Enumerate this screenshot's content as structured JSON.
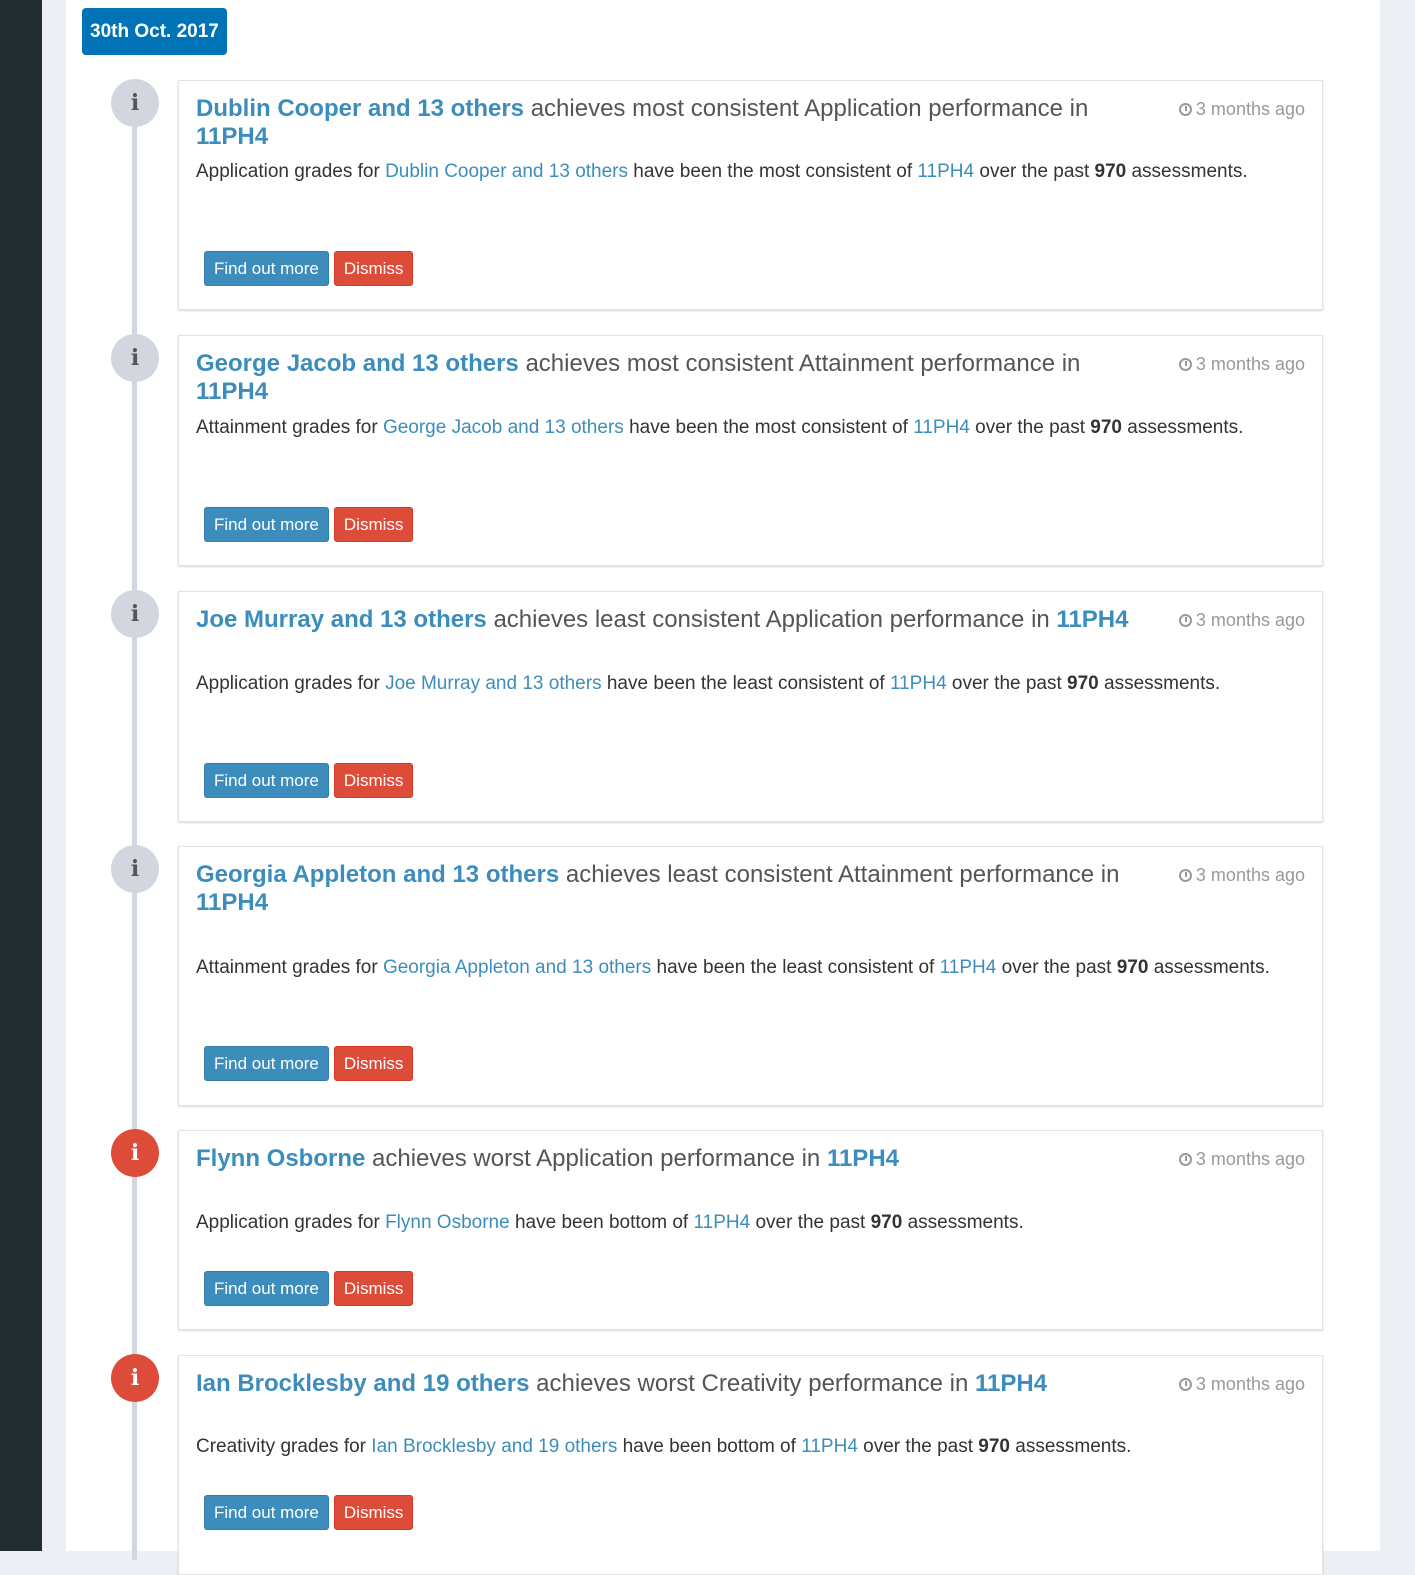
{
  "date_label": "30th Oct. 2017",
  "icon_glyph": "i",
  "items": [
    {
      "level": "info",
      "icon": "info-icon",
      "title_subject": "Dublin Cooper and 13 others",
      "title_middle": "achieves most consistent Application performance in",
      "title_class": "11PH4",
      "time": "3 months ago",
      "body_prefix": "Application grades for",
      "body_subject": "Dublin Cooper and 13 others",
      "body_middle": "have been the most consistent of",
      "body_class": "11PH4",
      "body_past": "over the past",
      "body_count": "970",
      "body_suffix": "assessments.",
      "find_label": "Find out more",
      "dismiss_label": "Dismiss"
    },
    {
      "level": "info",
      "icon": "info-icon",
      "title_subject": "George Jacob and 13 others",
      "title_middle": "achieves most consistent Attainment performance in",
      "title_class": "11PH4",
      "time": "3 months ago",
      "body_prefix": "Attainment grades for",
      "body_subject": "George Jacob and 13 others",
      "body_middle": "have been the most consistent of",
      "body_class": "11PH4",
      "body_past": "over the past",
      "body_count": "970",
      "body_suffix": "assessments.",
      "find_label": "Find out more",
      "dismiss_label": "Dismiss"
    },
    {
      "level": "info",
      "icon": "info-icon",
      "title_subject": "Joe Murray and 13 others",
      "title_middle": "achieves least consistent Application performance in",
      "title_class": "11PH4",
      "time": "3 months ago",
      "body_prefix": "Application grades for",
      "body_subject": "Joe Murray and 13 others",
      "body_middle": "have been the least consistent of",
      "body_class": "11PH4",
      "body_past": "over the past",
      "body_count": "970",
      "body_suffix": "assessments.",
      "find_label": "Find out more",
      "dismiss_label": "Dismiss"
    },
    {
      "level": "info",
      "icon": "info-icon",
      "title_subject": "Georgia Appleton and 13 others",
      "title_middle": "achieves least consistent Attainment performance in",
      "title_class": "11PH4",
      "time": "3 months ago",
      "body_prefix": "Attainment grades for",
      "body_subject": "Georgia Appleton and 13 others",
      "body_middle": "have been the least consistent of",
      "body_class": "11PH4",
      "body_past": "over the past",
      "body_count": "970",
      "body_suffix": "assessments.",
      "find_label": "Find out more",
      "dismiss_label": "Dismiss"
    },
    {
      "level": "danger",
      "icon": "info-icon",
      "title_subject": "Flynn Osborne",
      "title_middle": "achieves worst Application performance in",
      "title_class": "11PH4",
      "time": "3 months ago",
      "body_prefix": "Application grades for",
      "body_subject": "Flynn Osborne",
      "body_middle": "have been bottom of",
      "body_class": "11PH4",
      "body_past": "over the past",
      "body_count": "970",
      "body_suffix": "assessments.",
      "find_label": "Find out more",
      "dismiss_label": "Dismiss"
    },
    {
      "level": "danger",
      "icon": "info-icon",
      "title_subject": "Ian Brocklesby and 19 others",
      "title_middle": "achieves worst Creativity performance in",
      "title_class": "11PH4",
      "time": "3 months ago",
      "body_prefix": "Creativity grades for",
      "body_subject": "Ian Brocklesby and 19 others",
      "body_middle": "have been bottom of",
      "body_class": "11PH4",
      "body_past": "over the past",
      "body_count": "970",
      "body_suffix": "assessments.",
      "find_label": "Find out more",
      "dismiss_label": "Dismiss"
    }
  ]
}
